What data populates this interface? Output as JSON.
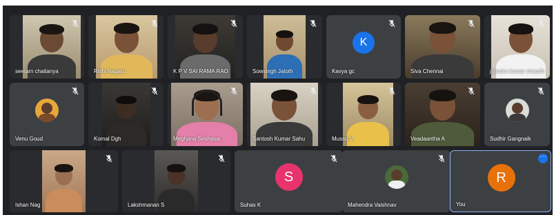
{
  "call": {
    "self_label": "You",
    "participants": [
      {
        "name": "seetam chaitanya",
        "kind": "video"
      },
      {
        "name": "Rishi Nagaru",
        "kind": "video"
      },
      {
        "name": "K P V SAI RAMA RAO",
        "kind": "video"
      },
      {
        "name": "Sowsingh Jatoth",
        "kind": "video"
      },
      {
        "name": "Kavya gc",
        "kind": "letter",
        "letter": "K"
      },
      {
        "name": "Siva Chennai",
        "kind": "video"
      },
      {
        "name": "jitendra kumar chaudh",
        "kind": "video"
      },
      {
        "name": "Venu Goud",
        "kind": "photo"
      },
      {
        "name": "Komal Dgh",
        "kind": "video"
      },
      {
        "name": "Meghana Seshasai",
        "kind": "video"
      },
      {
        "name": "Santosh Kumar Sahu",
        "kind": "video"
      },
      {
        "name": "Mussu V",
        "kind": "video"
      },
      {
        "name": "Veadaantha A",
        "kind": "video"
      },
      {
        "name": "Sudhir Gangnaik",
        "kind": "photo"
      },
      {
        "name": "Ishan Nag",
        "kind": "video"
      },
      {
        "name": "Lakshmanan S",
        "kind": "video"
      },
      {
        "name": "Suhas K",
        "kind": "letter",
        "letter": "S"
      },
      {
        "name": "Mahendra Vaishnav",
        "kind": "photo"
      },
      {
        "name": "You",
        "kind": "letter",
        "letter": "R"
      }
    ]
  },
  "colors": {
    "stage_bg": "#202124",
    "tile_bg": "#3c4043",
    "avatar_K": "#1a73e8",
    "avatar_S": "#e8336d",
    "avatar_R": "#e8710a",
    "active_border": "#8ab4f8"
  },
  "icons": {
    "mic": "mic-off-icon",
    "more": "more-options-icon"
  }
}
